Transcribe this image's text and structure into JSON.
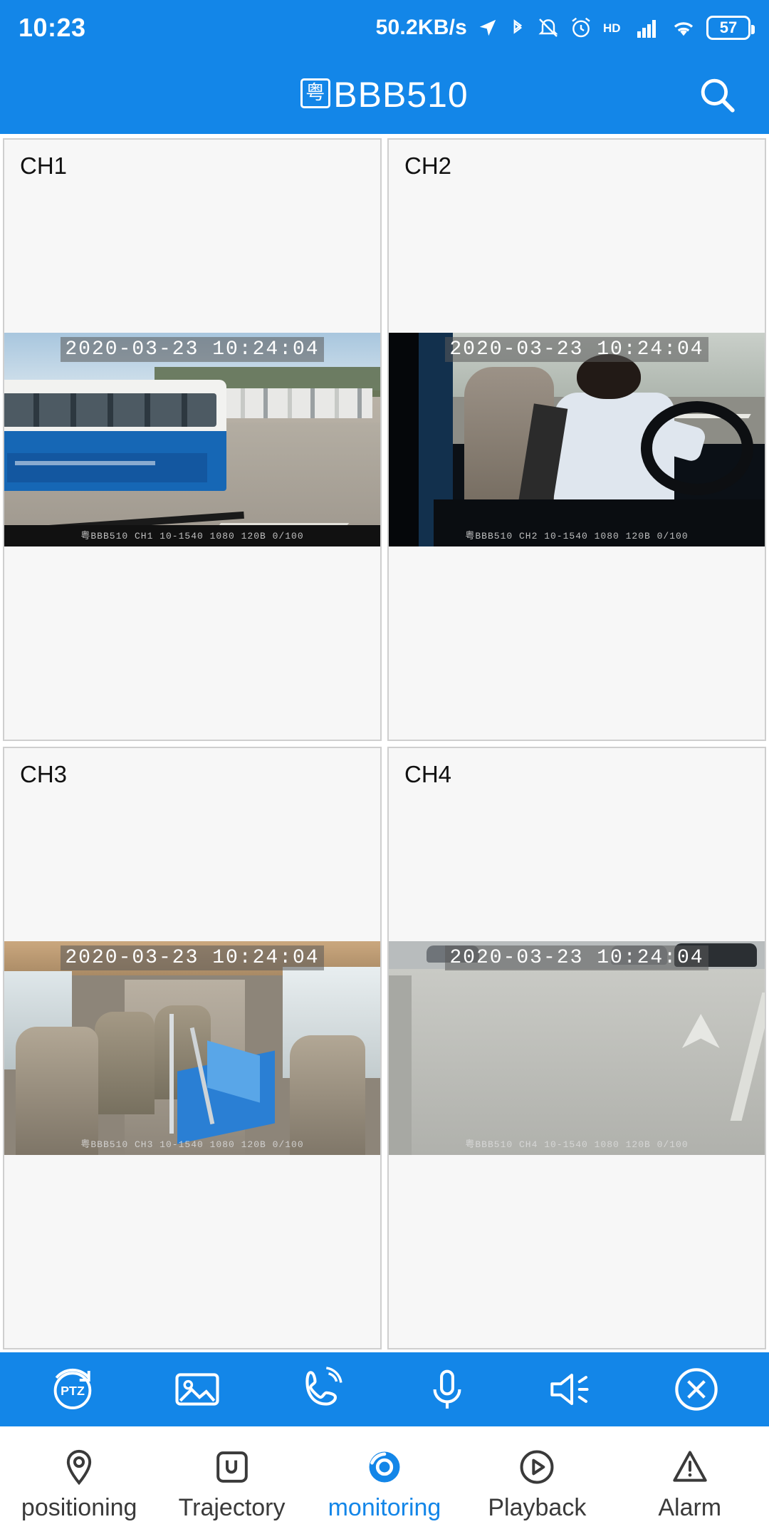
{
  "status_bar": {
    "clock": "10:23",
    "network_speed": "50.2KB/s",
    "battery_percent": "57",
    "icons": [
      "location-arrow-icon",
      "bluetooth-icon",
      "mute-bell-icon",
      "alarm-clock-icon",
      "hd-icon",
      "cellular-signal-icon",
      "wifi-icon",
      "battery-icon"
    ]
  },
  "title_bar": {
    "plate_prefix": "粤",
    "plate_number": "BBB510",
    "search_icon": "search-icon"
  },
  "channels": [
    {
      "label": "CH1",
      "timestamp": "2020-03-23 10:24:04",
      "footer": "粤BBB510  CH1 10-1540 1080 120B 0/100"
    },
    {
      "label": "CH2",
      "timestamp": "2020-03-23 10:24:04",
      "footer": "粤BBB510  CH2 10-1540 1080 120B 0/100"
    },
    {
      "label": "CH3",
      "timestamp": "2020-03-23 10:24:04",
      "footer": "粤BBB510  CH3 10-1540 1080 120B 0/100"
    },
    {
      "label": "CH4",
      "timestamp": "2020-03-23 10:24:04",
      "footer": "粤BBB510  CH4 10-1540 1080 120B 0/100"
    }
  ],
  "control_bar": {
    "items": [
      {
        "name": "ptz-button",
        "label": "PTZ",
        "icon": "ptz-rotate-icon"
      },
      {
        "name": "snapshot-button",
        "label": "",
        "icon": "image-icon"
      },
      {
        "name": "call-button",
        "label": "",
        "icon": "phone-call-icon"
      },
      {
        "name": "microphone-button",
        "label": "",
        "icon": "microphone-icon"
      },
      {
        "name": "speaker-button",
        "label": "",
        "icon": "speaker-icon"
      },
      {
        "name": "close-button",
        "label": "",
        "icon": "close-circle-icon"
      }
    ]
  },
  "bottom_nav": {
    "active_index": 2,
    "items": [
      {
        "label": "positioning",
        "icon": "map-pin-icon"
      },
      {
        "label": "Trajectory",
        "icon": "route-icon"
      },
      {
        "label": "monitoring",
        "icon": "eye-circle-icon"
      },
      {
        "label": "Playback",
        "icon": "play-circle-icon"
      },
      {
        "label": "Alarm",
        "icon": "warning-triangle-icon"
      }
    ]
  },
  "colors": {
    "accent": "#1386e8",
    "nav_text": "#3a3a3a",
    "cell_bg": "#f7f7f7",
    "cell_border": "#cfcfcf"
  }
}
